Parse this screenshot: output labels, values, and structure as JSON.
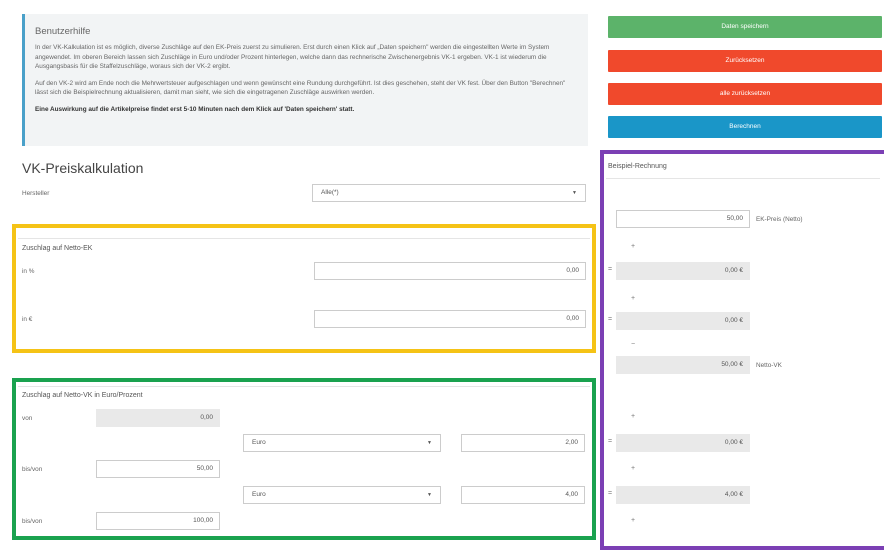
{
  "help": {
    "title": "Benutzerhilfe",
    "p1": "In der VK-Kalkulation ist es möglich, diverse Zuschläge auf den EK-Preis zuerst zu simulieren. Erst durch einen Klick auf „Daten speichern\" werden die eingestellten Werte im System angewendet. Im oberen Bereich lassen sich Zuschläge in Euro und/oder Prozent hinterlegen, welche dann das rechnerische Zwischenergebnis VK-1 ergeben. VK-1 ist wiederum die Ausgangsbasis für die Staffelzuschläge, woraus sich der VK-2 ergibt.",
    "p2": "Auf den VK-2 wird am Ende noch die Mehrwertsteuer aufgeschlagen und wenn gewünscht eine Rundung durchgeführt. Ist dies geschehen, steht der VK fest. Über den Button \"Berechnen\" lässt sich die Beispielrechnung aktualisieren, damit man sieht, wie sich die eingetragenen Zuschläge auswirken werden.",
    "p3": "Eine Auswirkung auf die Artikelpreise findet erst 5-10 Minuten nach dem Klick auf 'Daten speichern' statt."
  },
  "buttons": {
    "save": "Daten speichern",
    "reset": "Zurücksetzen",
    "reset_all": "alle zurücksetzen",
    "calculate": "Berechnen"
  },
  "calc": {
    "title": "VK-Preiskalkulation",
    "manufacturer_label": "Hersteller",
    "manufacturer_value": "Alle(*)"
  },
  "netto_ek": {
    "title": "Zuschlag auf Netto-EK",
    "percent_label": "in %",
    "percent_value": "0,00",
    "euro_label": "in €",
    "euro_value": "0,00"
  },
  "netto_vk": {
    "title": "Zuschlag auf Netto-VK in Euro/Prozent",
    "von_label": "von",
    "von_value": "0,00",
    "unit1": "Euro",
    "amount1": "2,00",
    "bisvon1_label": "bis/von",
    "bisvon1_value": "50,00",
    "unit2": "Euro",
    "amount2": "4,00",
    "bisvon2_label": "bis/von",
    "bisvon2_value": "100,00"
  },
  "example": {
    "title": "Beispiel-Rechnung",
    "ek_value": "50,00",
    "ek_label": "EK-Preis (Netto)",
    "plus": "+",
    "equals": "=",
    "minus": "−",
    "r1": "0,00 €",
    "r2": "0,00 €",
    "netto_vk_value": "50,00 €",
    "netto_vk_label": "Netto-VK",
    "r3": "0,00 €",
    "r4": "4,00 €"
  },
  "colors": {
    "save": "#5cb36a",
    "reset": "#f0492c",
    "calculate": "#1a96c8",
    "frame_yellow": "#f5c316",
    "frame_green": "#1aa24f",
    "frame_purple": "#7b3fb4"
  }
}
